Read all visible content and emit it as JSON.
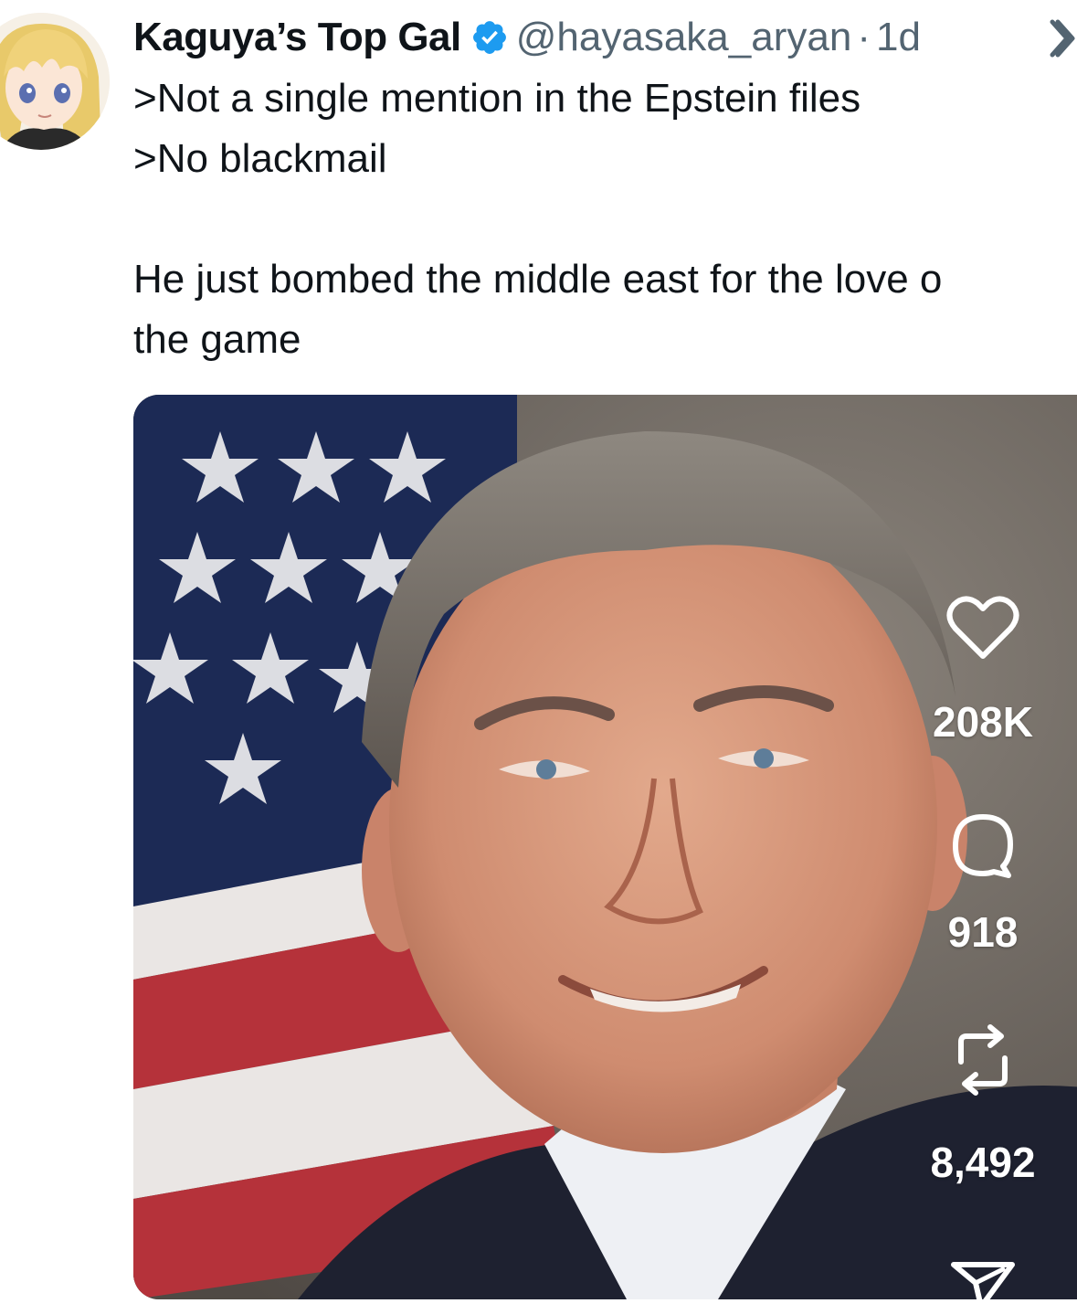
{
  "author": {
    "display_name": "Kaguya’s Top Gal",
    "handle": "@hayasaka_aryan",
    "separator": "·",
    "time_ago": "1d",
    "verified": true,
    "avatar_icon": "anime-girl-avatar"
  },
  "tweet": {
    "lines": [
      ">Not a single mention in the Epstein files",
      ">No blackmail",
      "He just bombed the middle east for the love o",
      "the game"
    ]
  },
  "media": {
    "description_icon": "portrait-photo"
  },
  "actions": {
    "likes": "208K",
    "replies": "918",
    "reposts": "8,492"
  },
  "colors": {
    "verified_blue": "#1d9bf0",
    "secondary_text": "#536471",
    "primary_text": "#0f1419"
  }
}
